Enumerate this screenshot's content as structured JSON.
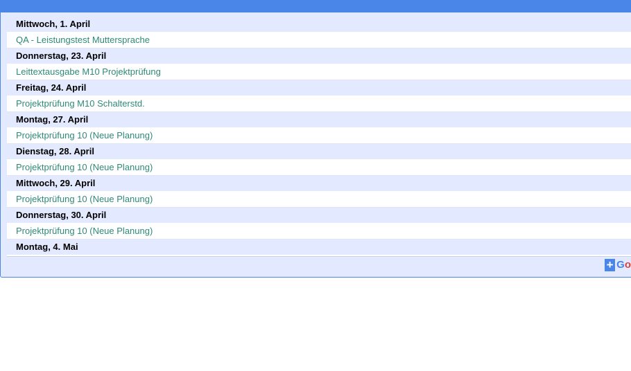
{
  "agenda": [
    {
      "day": "Mittwoch, 1. April",
      "events": [
        "QA - Leistungstest Muttersprache"
      ]
    },
    {
      "day": "Donnerstag, 23. April",
      "events": [
        "Leittextausgabe M10 Projektprüfung"
      ]
    },
    {
      "day": "Freitag, 24. April",
      "events": [
        "Projektprüfung M10 Schalterstd."
      ]
    },
    {
      "day": "Montag, 27. April",
      "events": [
        "Projektprüfung 10 (Neue Planung)"
      ]
    },
    {
      "day": "Dienstag, 28. April",
      "events": [
        "Projektprüfung 10 (Neue Planung)"
      ]
    },
    {
      "day": "Mittwoch, 29. April",
      "events": [
        "Projektprüfung 10 (Neue Planung)"
      ]
    },
    {
      "day": "Donnerstag, 30. April",
      "events": [
        "Projektprüfung 10 (Neue Planung)"
      ]
    },
    {
      "day": "Montag, 4. Mai",
      "events": []
    }
  ],
  "footer": {
    "add_button": {
      "icon": "plus-icon",
      "plus": "+",
      "text_g": "G",
      "text_o": "o"
    }
  },
  "colors": {
    "frame": "#4a86e8",
    "day_header_bg": "#e3e9ff",
    "event_text": "#2e8a76"
  }
}
